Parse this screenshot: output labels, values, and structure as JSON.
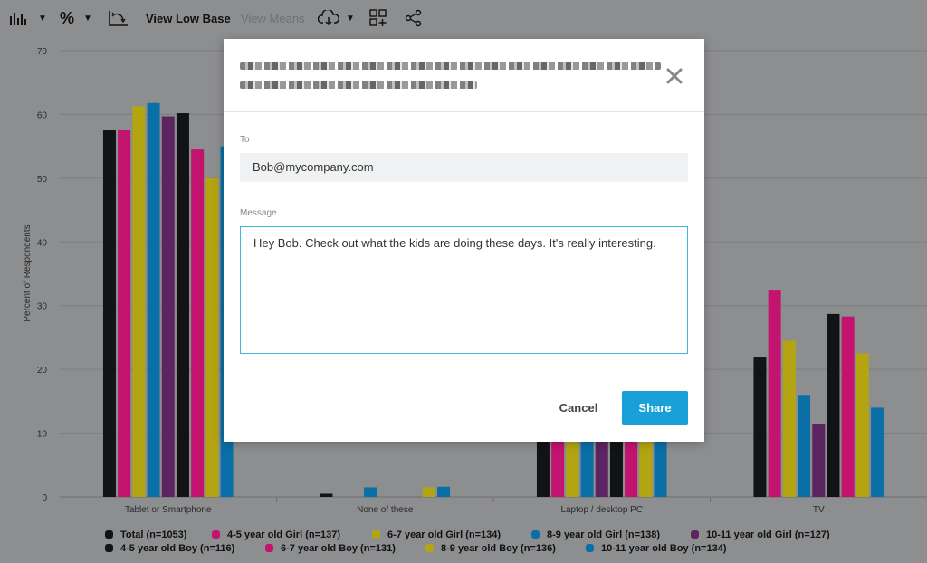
{
  "toolbar": {
    "view_low_base": "View Low Base",
    "view_means": "View Means",
    "icons": [
      "bar-chart-icon",
      "percent-icon",
      "swap-axes-icon",
      "cloud-download-icon",
      "add-widget-icon",
      "share-icon"
    ]
  },
  "modal": {
    "title_redacted": true,
    "to_label": "To",
    "to_value": "Bob@mycompany.com",
    "message_label": "Message",
    "message_value": "Hey Bob. Check out what the kids are doing these days.  It's really interesting.",
    "cancel_label": "Cancel",
    "share_label": "Share",
    "share_color": "#1aa0d8"
  },
  "chart_data": {
    "type": "bar",
    "ylabel": "Percent of Respondents",
    "ylim": [
      0,
      70
    ],
    "yticks": [
      0,
      10,
      20,
      30,
      40,
      50,
      60,
      70
    ],
    "categories": [
      "Tablet or Smartphone",
      "None of these",
      "Laptop / desktop PC",
      "TV"
    ],
    "grid": true,
    "legend_position": "bottom",
    "series": [
      {
        "name": "Total (n=1053)",
        "color": "#121316",
        "values": [
          57.5,
          0.5,
          10,
          22
        ]
      },
      {
        "name": "4-5 year old Girl (n=137)",
        "color": "#c2136e",
        "values": [
          57.5,
          0,
          10,
          32.5
        ]
      },
      {
        "name": "6-7 year old Girl (n=134)",
        "color": "#b3a511",
        "values": [
          61.3,
          0,
          10,
          24.5
        ]
      },
      {
        "name": "8-9 year old Girl (n=138)",
        "color": "#0a6fa6",
        "values": [
          61.8,
          1.5,
          10,
          16
        ]
      },
      {
        "name": "10-11 year old Girl (n=127)",
        "color": "#5c2460",
        "values": [
          59.7,
          0,
          10,
          11.5
        ]
      },
      {
        "name": "4-5 year old Boy (n=116)",
        "color": "#121316",
        "values": [
          60.2,
          0,
          10,
          28.7
        ]
      },
      {
        "name": "6-7 year old Boy (n=131)",
        "color": "#c2136e",
        "values": [
          54.5,
          0,
          10,
          28.3
        ]
      },
      {
        "name": "8-9 year old Boy (n=136)",
        "color": "#b3a511",
        "values": [
          50,
          1.5,
          10,
          22.5
        ]
      },
      {
        "name": "10-11 year old Boy (n=134)",
        "color": "#0a6fa6",
        "values": [
          55,
          1.6,
          10,
          14
        ]
      }
    ]
  }
}
